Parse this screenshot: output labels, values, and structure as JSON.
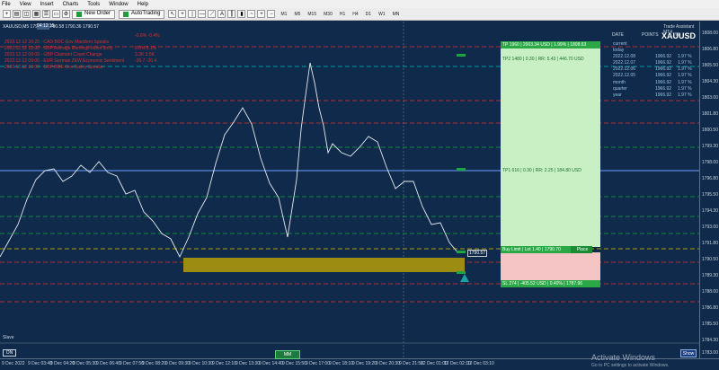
{
  "menu": [
    "File",
    "View",
    "Insert",
    "Charts",
    "Tools",
    "Window",
    "Help"
  ],
  "toolbar": {
    "new_order": "New Order",
    "autotrading": "AutoTrading",
    "timeframes": [
      "M1",
      "M5",
      "M15",
      "M30",
      "H1",
      "H4",
      "D1",
      "W1",
      "MN"
    ]
  },
  "chart": {
    "title": "XAUUSD,M5 1790.48 1790.58 1790.36 1790.57",
    "timer": "04:12:15",
    "symbol": "XAUUSD",
    "panel_title": "Trade Assistant MT4",
    "panel_cols": [
      "DATE",
      "POINTS",
      "%"
    ],
    "panel_rows": [
      {
        "label": "current",
        "points": "",
        "pct": ""
      },
      {
        "label": "today",
        "points": "",
        "pct": ""
      },
      {
        "label": "2022.12.08",
        "points": "1966.92",
        "pct": "1.97 %"
      },
      {
        "label": "2022.12.07",
        "points": "1966.92",
        "pct": "1.97 %"
      },
      {
        "label": "2022.12.06",
        "points": "1966.92",
        "pct": "1.97 %"
      },
      {
        "label": "2022.12.05",
        "points": "1966.92",
        "pct": "1.97 %"
      },
      {
        "label": "month",
        "points": "1966.92",
        "pct": "1.97 %"
      },
      {
        "label": "quarter",
        "points": "1966.92",
        "pct": "1.97 %"
      },
      {
        "label": "year",
        "points": "1966.92",
        "pct": "1.97 %"
      }
    ],
    "news": [
      {
        "time": "2022.12.12 20:20 - CAD BOC Gov Macklem Speaks",
        "vals": "-0.6%  -0.4%"
      },
      {
        "time": "2022.12.12 12:00 - GBP Average Earnings Index 3m/y",
        "vals": "6.0%  5.1%"
      },
      {
        "time": "2022.12.12 09:00 - GBP Claimant Count Change",
        "vals": "3.3K  3.5K"
      },
      {
        "time": "2022.12.12 09:00 - EUR German ZEW Economic Sentiment",
        "vals": "-36.7  -26.4"
      },
      {
        "time": "2022.12.12 13:00 - GBP BOE Gov Bailey Speaks",
        "vals": ""
      }
    ],
    "levels": {
      "tp": "TP 1960 | 2003.34 USD | 1.99% | 1808.63",
      "tp2": "TP2 1480 | 0.30 | RR: 5.43 | 446.70 USD",
      "tp1": "TP1 616 | 0.30 | RR: 2.25 | 184.80 USD",
      "entry": "Buy Limit | Lot 1.40 | 1790.70",
      "place": "Place",
      "sl": "SL 274 | -405.52 USD | 0.40% | 1787.96",
      "current_price": "1790.57"
    },
    "price_axis": [
      "1808.00",
      "1806.80",
      "1805.50",
      "1804.30",
      "1803.00",
      "1801.80",
      "1800.50",
      "1799.30",
      "1798.00",
      "1796.80",
      "1795.50",
      "1794.30",
      "1793.00",
      "1791.80",
      "1790.50",
      "1789.30",
      "1788.00",
      "1786.80",
      "1785.50",
      "1784.30",
      "1783.00"
    ],
    "time_axis": [
      "9 Dec 2022",
      "9 Dec 03:40",
      "9 Dec 04:20",
      "9 Dec 05:30",
      "9 Dec 06:40",
      "9 Dec 07:50",
      "9 Dec 08:20",
      "9 Dec 09:30",
      "9 Dec 10:30",
      "9 Dec 12:10",
      "9 Dec 13:30",
      "9 Dec 14:40",
      "9 Dec 15:50",
      "9 Dec 17:00",
      "9 Dec 18:10",
      "9 Dec 19:20",
      "9 Dec 20:30",
      "9 Dec 21:50",
      "12 Dec 01:00",
      "12 Dec 02:10",
      "12 Dec 03:10"
    ]
  },
  "buttons": {
    "on": "ON",
    "mm": "MM",
    "show": "Show",
    "slave": "Slave"
  },
  "watermark": {
    "line1": "Activate Windows",
    "line2": "Go to PC settings to activate Windows."
  }
}
